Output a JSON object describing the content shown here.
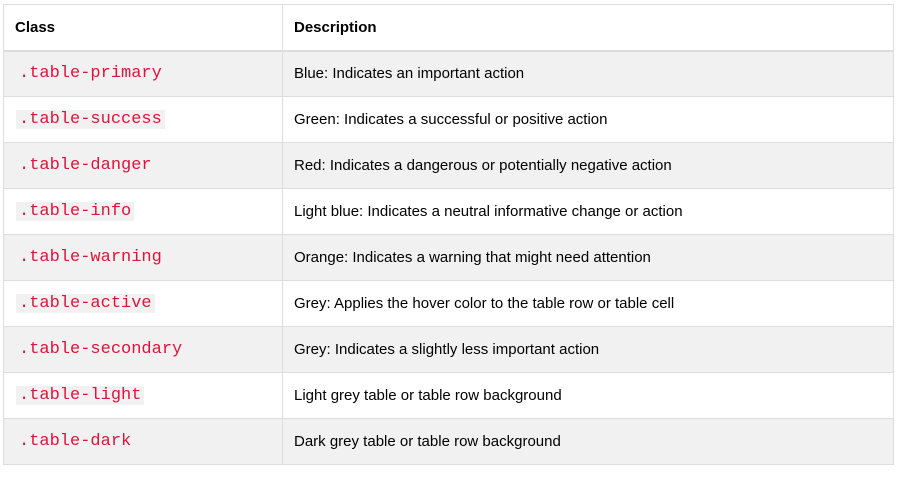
{
  "table": {
    "headers": {
      "class": "Class",
      "description": "Description"
    },
    "rows": [
      {
        "class": ".table-primary",
        "description": "Blue: Indicates an important action"
      },
      {
        "class": ".table-success",
        "description": "Green: Indicates a successful or positive action"
      },
      {
        "class": ".table-danger",
        "description": "Red: Indicates a dangerous or potentially negative action"
      },
      {
        "class": ".table-info",
        "description": "Light blue: Indicates a neutral informative change or action"
      },
      {
        "class": ".table-warning",
        "description": "Orange: Indicates a warning that might need attention"
      },
      {
        "class": ".table-active",
        "description": "Grey: Applies the hover color to the table row or table cell"
      },
      {
        "class": ".table-secondary",
        "description": "Grey: Indicates a slightly less important action"
      },
      {
        "class": ".table-light",
        "description": "Light grey table or table row background"
      },
      {
        "class": ".table-dark",
        "description": "Dark grey table or table row background"
      }
    ]
  },
  "colors": {
    "code_text": "#dc143c",
    "stripe_bg": "#f1f1f1",
    "border": "#dddddd"
  }
}
